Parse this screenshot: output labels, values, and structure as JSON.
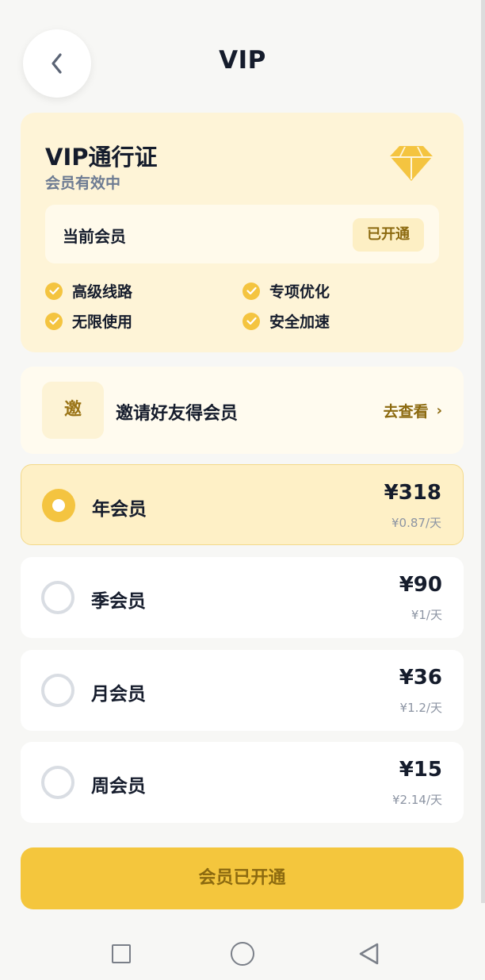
{
  "header": {
    "title": "VIP",
    "back_icon": "chevron-left-icon"
  },
  "vip_card": {
    "title": "VIP通行证",
    "subtitle": "会员有效中",
    "icon": "diamond-icon",
    "member_label": "当前会员",
    "member_status": "已开通",
    "features": [
      "高级线路",
      "专项优化",
      "无限使用",
      "安全加速"
    ]
  },
  "invite": {
    "badge": "邀",
    "text": "邀请好友得会员",
    "link": "去查看",
    "link_icon": "›"
  },
  "plans": [
    {
      "name": "年会员",
      "price": "¥318",
      "daily": "¥0.87/天",
      "selected": true
    },
    {
      "name": "季会员",
      "price": "¥90",
      "daily": "¥1/天",
      "selected": false
    },
    {
      "name": "月会员",
      "price": "¥36",
      "daily": "¥1.2/天",
      "selected": false
    },
    {
      "name": "周会员",
      "price": "¥15",
      "daily": "¥2.14/天",
      "selected": false
    }
  ],
  "cta": {
    "label": "会员已开通"
  },
  "colors": {
    "accent": "#f4c63d",
    "card_bg": "#fef4d7",
    "selected_bg": "#fef0c6",
    "text_dark": "#151c2c",
    "text_gold": "#8c6a10"
  },
  "nav": {
    "icons": [
      "square-recent-icon",
      "circle-home-icon",
      "triangle-back-icon"
    ]
  }
}
